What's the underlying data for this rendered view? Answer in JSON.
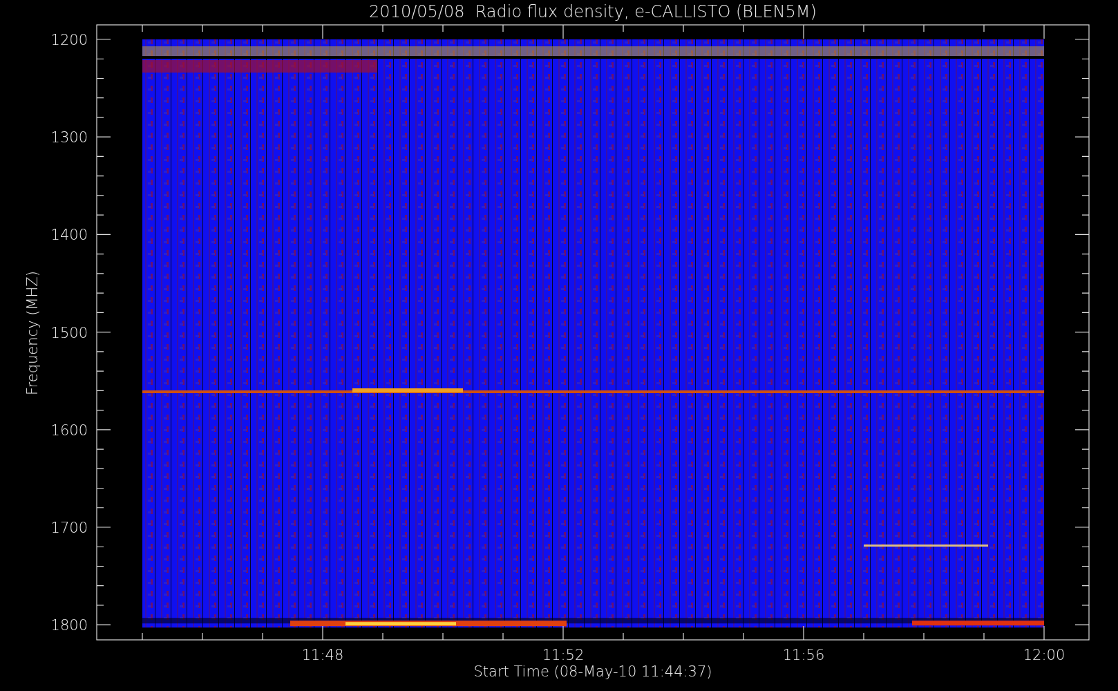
{
  "title": "2010/05/08  Radio flux density, e-CALLISTO (BLEN5M)",
  "y_axis": {
    "label": "Frequency (MHZ)",
    "ticks": [
      "1200",
      "1300",
      "1400",
      "1500",
      "1600",
      "1700",
      "1800"
    ]
  },
  "x_axis": {
    "label": "Start Time (08-May-10 11:44:37)",
    "ticks": [
      "11:48",
      "11:52",
      "11:56",
      "12:00"
    ]
  }
}
